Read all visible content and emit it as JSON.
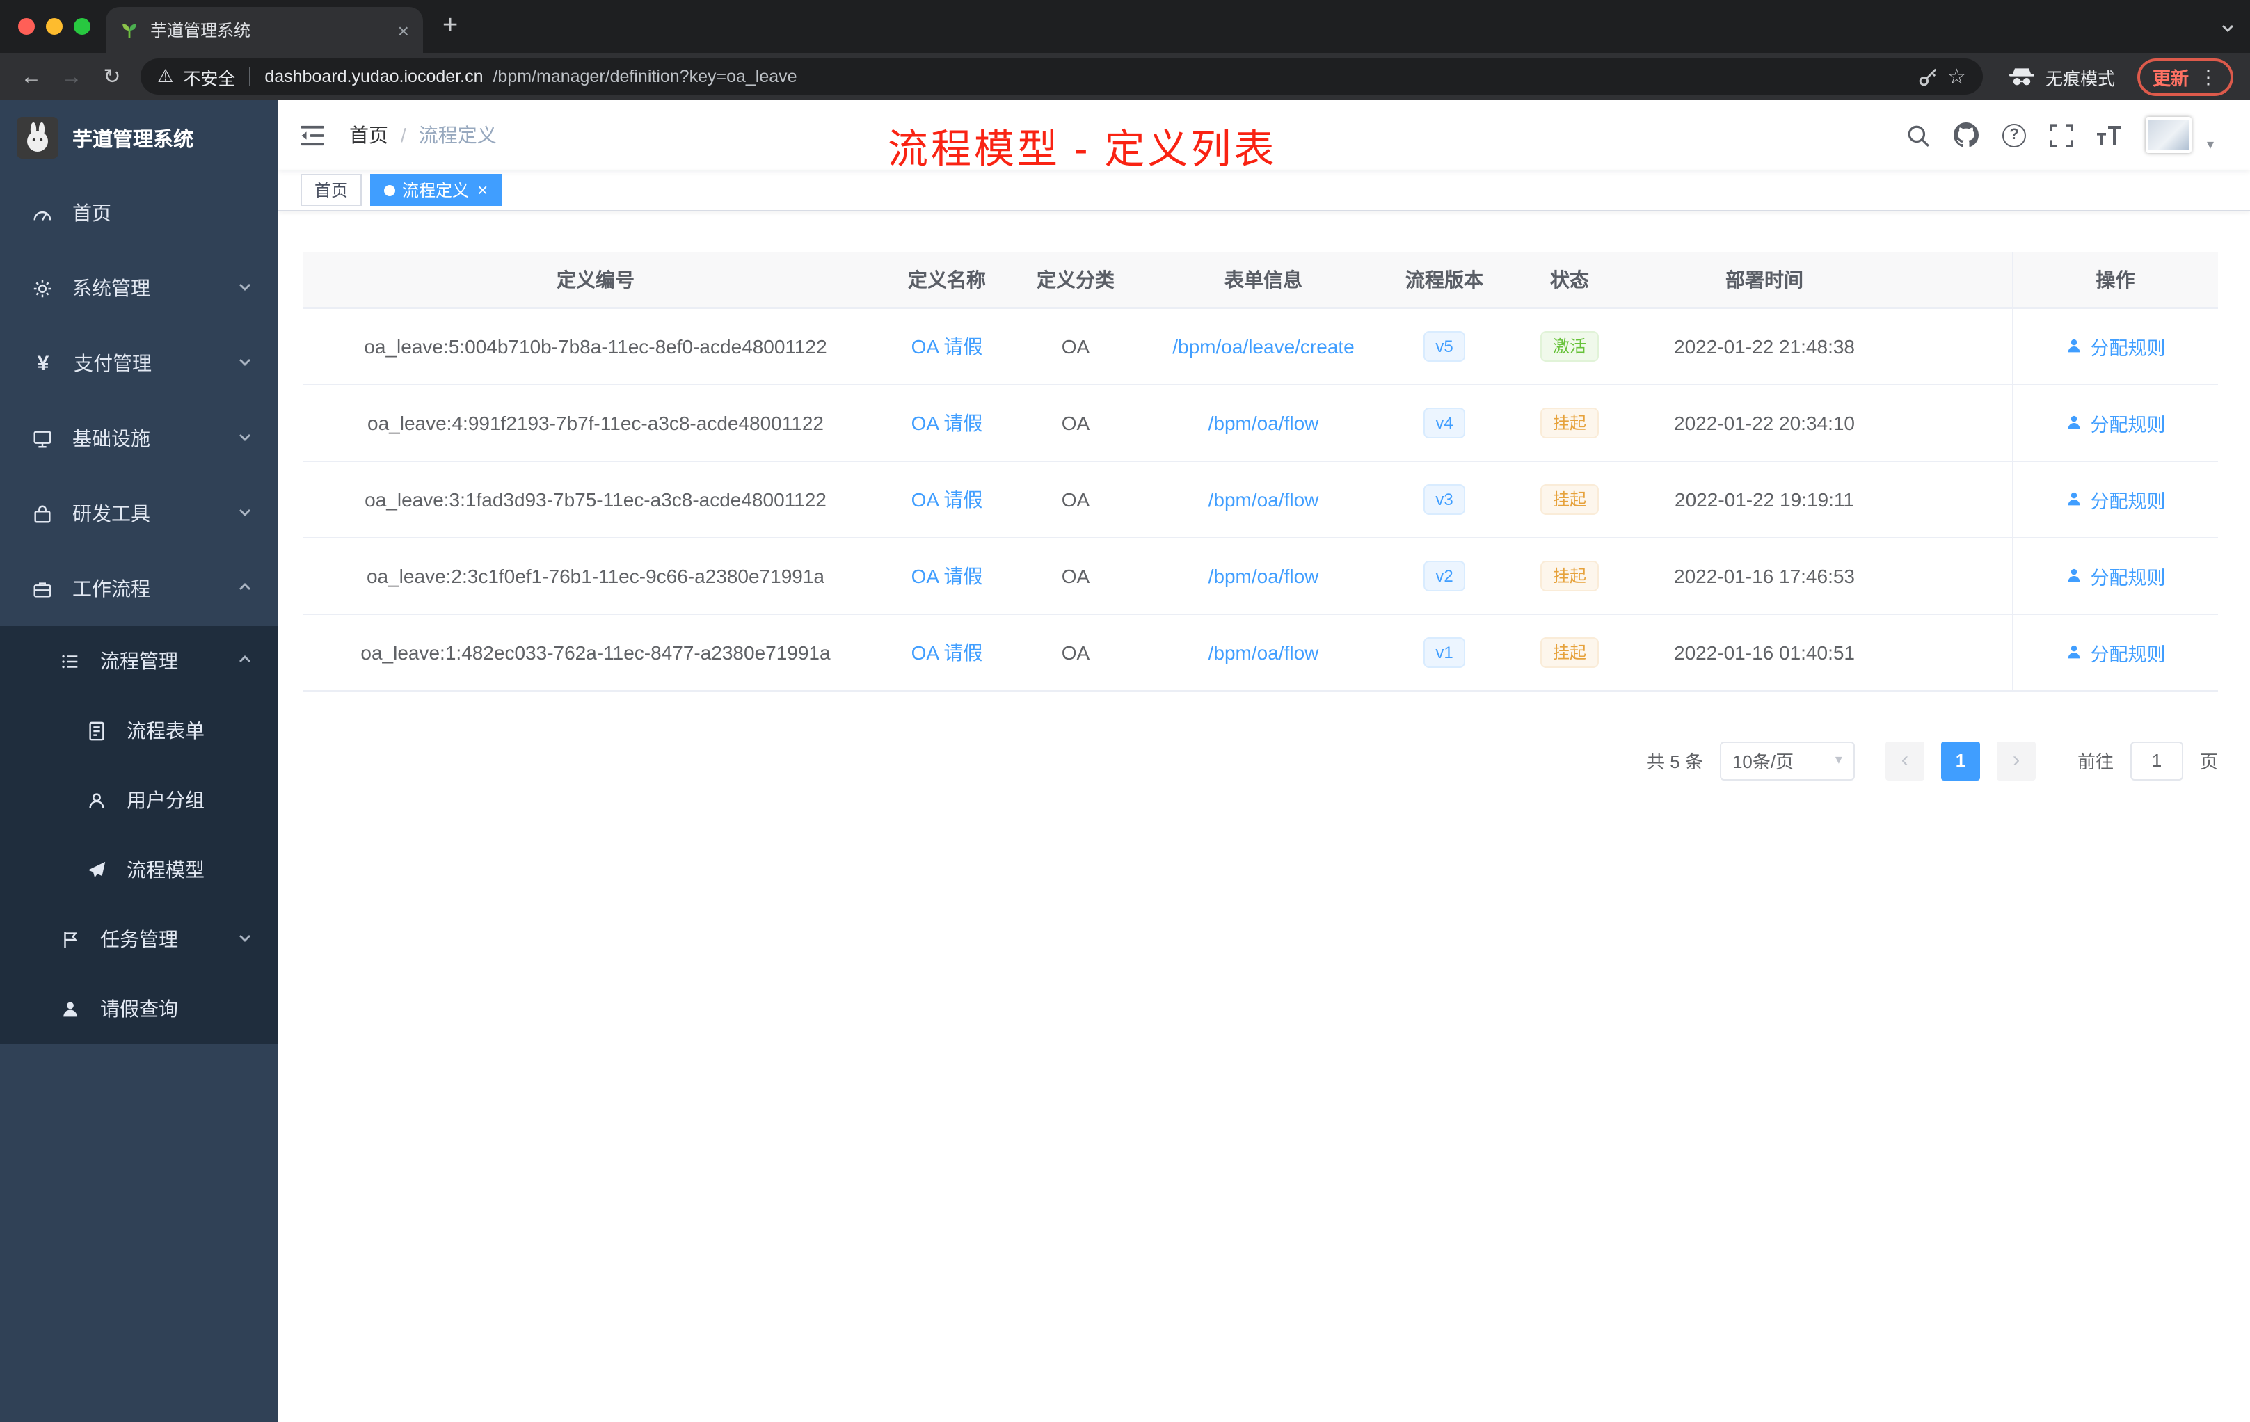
{
  "colors": {
    "accent": "#409eff",
    "success": "#67c23a",
    "warning": "#e6a23c",
    "annotation_red": "#f92313",
    "sidebar_bg": "#304156",
    "submenu_bg": "#1f2d3d",
    "traffic_red": "#ff5f57",
    "traffic_yellow": "#febc2e",
    "traffic_green": "#28c840"
  },
  "icons": {
    "close": "×",
    "plus": "+",
    "back": "←",
    "forward": "→",
    "reload": "↻",
    "warning": "⚠",
    "star": "☆",
    "menu_dots": "⋮",
    "caret_down": "▾",
    "prev": "‹",
    "next": "›",
    "question": "?",
    "yen": "¥",
    "breadcrumb_separator": "/"
  },
  "browser": {
    "tab_title": "芋道管理系统",
    "security_label": "不安全",
    "url_host": "dashboard.yudao.iocoder.cn",
    "url_path": "/bpm/manager/definition?key=oa_leave",
    "incognito_label": "无痕模式",
    "update_label": "更新"
  },
  "sidebar": {
    "app_title": "芋道管理系统",
    "items": [
      {
        "label": "首页"
      },
      {
        "label": "系统管理"
      },
      {
        "label": "支付管理"
      },
      {
        "label": "基础设施"
      },
      {
        "label": "研发工具"
      },
      {
        "label": "工作流程"
      },
      {
        "label": "流程管理"
      },
      {
        "label": "流程表单"
      },
      {
        "label": "用户分组"
      },
      {
        "label": "流程模型"
      },
      {
        "label": "任务管理"
      },
      {
        "label": "请假查询"
      }
    ]
  },
  "header": {
    "breadcrumb_home": "首页",
    "breadcrumb_current": "流程定义",
    "annotation": "流程模型 - 定义列表"
  },
  "tags": [
    {
      "label": "首页",
      "active": false
    },
    {
      "label": "流程定义",
      "active": true
    }
  ],
  "table": {
    "columns": [
      "定义编号",
      "定义名称",
      "定义分类",
      "表单信息",
      "流程版本",
      "状态",
      "部署时间",
      "操作"
    ],
    "action_label": "分配规则",
    "rows": [
      {
        "id": "oa_leave:5:004b710b-7b8a-11ec-8ef0-acde48001122",
        "name": "OA 请假",
        "category": "OA",
        "form": "/bpm/oa/leave/create",
        "version": "v5",
        "status": "激活",
        "status_type": "success",
        "time": "2022-01-22 21:48:38"
      },
      {
        "id": "oa_leave:4:991f2193-7b7f-11ec-a3c8-acde48001122",
        "name": "OA 请假",
        "category": "OA",
        "form": "/bpm/oa/flow",
        "version": "v4",
        "status": "挂起",
        "status_type": "warning",
        "time": "2022-01-22 20:34:10"
      },
      {
        "id": "oa_leave:3:1fad3d93-7b75-11ec-a3c8-acde48001122",
        "name": "OA 请假",
        "category": "OA",
        "form": "/bpm/oa/flow",
        "version": "v3",
        "status": "挂起",
        "status_type": "warning",
        "time": "2022-01-22 19:19:11"
      },
      {
        "id": "oa_leave:2:3c1f0ef1-76b1-11ec-9c66-a2380e71991a",
        "name": "OA 请假",
        "category": "OA",
        "form": "/bpm/oa/flow",
        "version": "v2",
        "status": "挂起",
        "status_type": "warning",
        "time": "2022-01-16 17:46:53"
      },
      {
        "id": "oa_leave:1:482ec033-762a-11ec-8477-a2380e71991a",
        "name": "OA 请假",
        "category": "OA",
        "form": "/bpm/oa/flow",
        "version": "v1",
        "status": "挂起",
        "status_type": "warning",
        "time": "2022-01-16 01:40:51"
      }
    ]
  },
  "pagination": {
    "total": "共 5 条",
    "page_size": "10条/页",
    "current_page": "1",
    "goto_label": "前往",
    "goto_value": "1",
    "page_unit": "页"
  }
}
